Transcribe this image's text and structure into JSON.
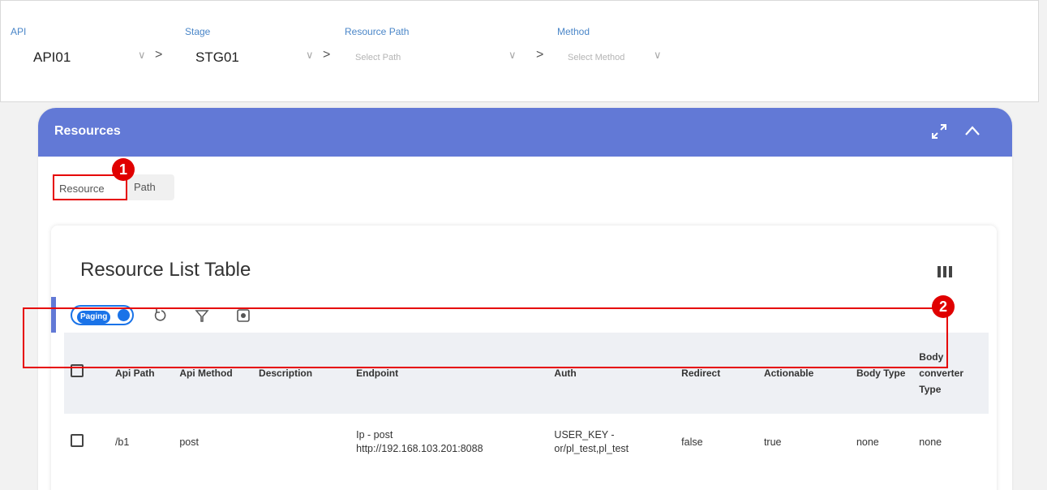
{
  "filters": {
    "api": {
      "label": "API",
      "value": "API01"
    },
    "stage": {
      "label": "Stage",
      "value": "STG01"
    },
    "resource_path": {
      "label": "Resource Path",
      "placeholder": "Select Path"
    },
    "method": {
      "label": "Method",
      "placeholder": "Select Method"
    }
  },
  "panel": {
    "title": "Resources"
  },
  "tabs": [
    {
      "label": "Resource"
    },
    {
      "label": "Path"
    }
  ],
  "badges": [
    "1",
    "2"
  ],
  "card": {
    "title": "Resource List Table"
  },
  "toolbar": {
    "paging_label": "Paging"
  },
  "table": {
    "columns": [
      "Api Path",
      "Api Method",
      "Description",
      "Endpoint",
      "Auth",
      "Redirect",
      "Actionable",
      "Body Type",
      "Body converter Type"
    ],
    "rows": [
      {
        "api_path": "/b1",
        "api_method": "post",
        "description": "",
        "endpoint_line1": "Ip - post",
        "endpoint_line2": "http://192.168.103.201:8088",
        "auth_line1": "USER_KEY -",
        "auth_line2": "or/pl_test,pl_test",
        "redirect": "false",
        "actionable": "true",
        "body_type": "none",
        "body_converter_type": "none"
      }
    ]
  },
  "colors": {
    "accent": "#6279d6",
    "highlight": "#e60000",
    "toggle": "#1a73e8"
  }
}
